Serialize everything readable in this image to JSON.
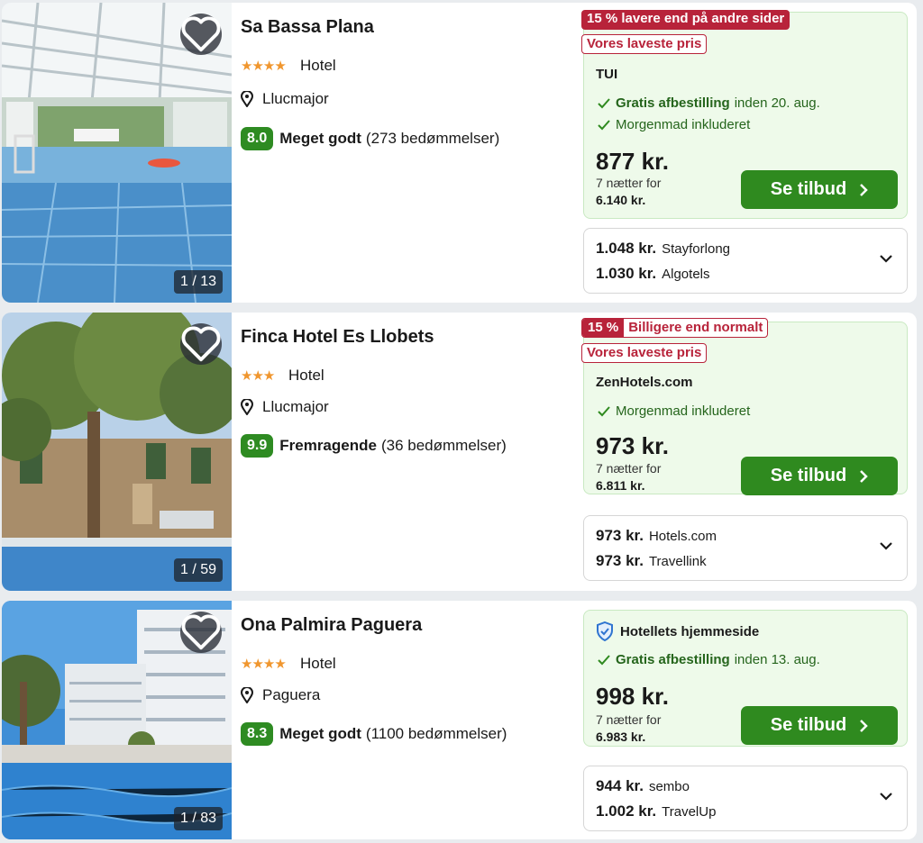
{
  "hotels": [
    {
      "name": "Sa Bassa Plana",
      "stars": "★★★★",
      "type": "Hotel",
      "location": "Llucmajor",
      "score": "8.0",
      "rating_label": "Meget godt",
      "reviews": "(273 bedømmelser)",
      "photo_counter": "1 / 13",
      "badge1": "15 % lavere end på andre sider",
      "badge2": "Vores laveste pris",
      "provider": "TUI",
      "perk1_bold": "Gratis afbestilling",
      "perk1_rest": "inden 20. aug.",
      "perk2": "Morgenmad inkluderet",
      "price": "877 kr.",
      "nights": "7 nætter for",
      "total": "6.140 kr.",
      "cta": "Se tilbud",
      "alternatives": [
        {
          "price": "1.048 kr.",
          "site": "Stayforlong"
        },
        {
          "price": "1.030 kr.",
          "site": "Algotels"
        }
      ]
    },
    {
      "name": "Finca Hotel Es Llobets",
      "stars": "★★★",
      "type": "Hotel",
      "location": "Llucmajor",
      "score": "9.9",
      "rating_label": "Fremragende",
      "reviews": "(36 bedømmelser)",
      "photo_counter": "1 / 59",
      "badge1_left": "15 %",
      "badge1_right": "Billigere end normalt",
      "badge2": "Vores laveste pris",
      "provider": "ZenHotels.com",
      "perk1": "Morgenmad inkluderet",
      "price": "973 kr.",
      "nights": "7 nætter for",
      "total": "6.811 kr.",
      "cta": "Se tilbud",
      "alternatives": [
        {
          "price": "973 kr.",
          "site": "Hotels.com"
        },
        {
          "price": "973 kr.",
          "site": "Travellink"
        }
      ]
    },
    {
      "name": "Ona Palmira Paguera",
      "stars": "★★★★",
      "type": "Hotel",
      "location": "Paguera",
      "score": "8.3",
      "rating_label": "Meget godt",
      "reviews": "(1100 bedømmelser)",
      "photo_counter": "1 / 83",
      "provider": "Hotellets hjemmeside",
      "perk1_bold": "Gratis afbestilling",
      "perk1_rest": "inden 13. aug.",
      "price": "998 kr.",
      "nights": "7 nætter for",
      "total": "6.983 kr.",
      "cta": "Se tilbud",
      "alternatives": [
        {
          "price": "944 kr.",
          "site": "sembo"
        },
        {
          "price": "1.002 kr.",
          "site": "TravelUp"
        }
      ]
    }
  ],
  "icons": {
    "favorite": "heart-icon",
    "location": "map-pin-icon",
    "check": "check-icon",
    "cta_arrow": "chevron-right-icon",
    "expand": "chevron-down-icon",
    "shield": "shield-check-icon"
  },
  "colors": {
    "accent_green": "#2f8a1f",
    "score_green": "#2e8b22",
    "deal_red": "#b8233a",
    "star_orange": "#f0962e",
    "offer_bg": "#eefaea"
  }
}
